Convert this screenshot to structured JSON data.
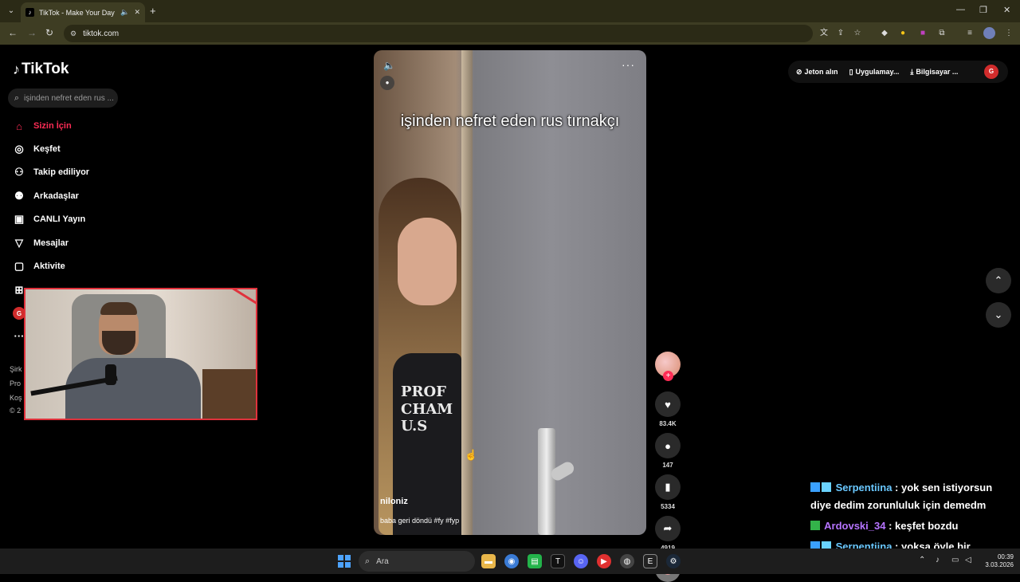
{
  "browser": {
    "tab_title": "TikTok - Make Your Day",
    "url": "tiktok.com"
  },
  "sidebar": {
    "logo_text": "TikTok",
    "search_placeholder": "işinden nefret eden rus ...",
    "items": [
      {
        "label": "Sizin İçin",
        "icon": "home-icon",
        "active": true
      },
      {
        "label": "Keşfet",
        "icon": "compass-icon"
      },
      {
        "label": "Takip ediliyor",
        "icon": "following-icon"
      },
      {
        "label": "Arkadaşlar",
        "icon": "friends-icon"
      },
      {
        "label": "CANLI Yayın",
        "icon": "live-icon"
      },
      {
        "label": "Mesajlar",
        "icon": "messages-icon"
      },
      {
        "label": "Aktivite",
        "icon": "activity-icon"
      }
    ],
    "profile_initial": "G",
    "footer_fragments": [
      "Şirk",
      "Pro",
      "Koş",
      "© 2"
    ]
  },
  "video": {
    "caption": "işinden nefret eden rus tırnakçı",
    "author": "niloniz",
    "description": "baba geri döndü #fy #fyp",
    "shirt_print": "PROF\nCHAM\nU.S"
  },
  "actions": {
    "likes": "83.4K",
    "comments": "147",
    "saves": "5334",
    "shares": "4919"
  },
  "header_links": {
    "coins": "Jeton alın",
    "app": "Uygulamay...",
    "desktop": "Bilgisayar ...",
    "user_initial": "G"
  },
  "chat": [
    {
      "user": "Serpentiina",
      "text": ": yok sen istiyorsun diye dedim zorunluluk için demedm"
    },
    {
      "user": "Ardovski_34",
      "text": ": keşfet bozdu"
    },
    {
      "user": "Serpentiina",
      "text": ": yoksa öyle bir zorunluluk olamaz"
    }
  ],
  "taskbar": {
    "search_placeholder": "Ara",
    "time": "00:39",
    "date": "3.03.2026"
  },
  "colors": {
    "accent": "#fe2c55",
    "chrome_frame": "#2b2a16",
    "chrome_toolbar": "#3e3d23"
  }
}
